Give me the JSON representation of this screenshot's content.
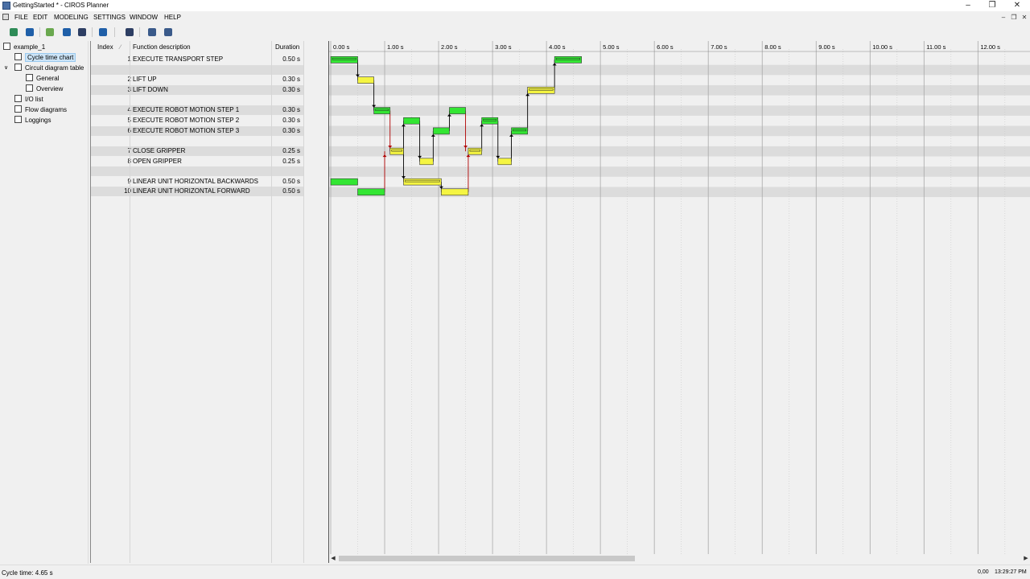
{
  "window": {
    "title": "GettingStarted * - CIROS Planner",
    "min_glyph": "–",
    "max_glyph": "❐",
    "close_glyph": "✕"
  },
  "menu": [
    "FILE",
    "EDIT",
    "MODELING",
    "SETTINGS",
    "WINDOW",
    "HELP"
  ],
  "mdi_controls": [
    "–",
    "❐",
    "✕"
  ],
  "toolbar": {
    "buttons": [
      "open-icon",
      "save-icon",
      "cut-icon",
      "copy-icon",
      "paste-icon",
      "help-icon",
      "window-icon",
      "user-icon",
      "export-icon"
    ],
    "colors": [
      "#2e8b57",
      "#1f5fa8",
      "#6aa84f",
      "#1f5fa8",
      "#2d3e63",
      "#1f5fa8",
      "#2d3e63",
      "#3a5a8a",
      "#3a5a8a"
    ]
  },
  "tree": [
    {
      "label": "example_1",
      "icon": "project-icon",
      "level": 0,
      "expanded": null,
      "selected": false
    },
    {
      "label": "Cycle time chart",
      "icon": "chart-icon",
      "level": 1,
      "expanded": null,
      "selected": true
    },
    {
      "label": "Circuit diagram table",
      "icon": "table-icon",
      "level": 1,
      "expanded": true,
      "selected": false
    },
    {
      "label": "General",
      "icon": "table-icon",
      "level": 2,
      "expanded": null,
      "selected": false
    },
    {
      "label": "Overview",
      "icon": "table-icon",
      "level": 2,
      "expanded": null,
      "selected": false
    },
    {
      "label": "I/O list",
      "icon": "list-icon",
      "level": 1,
      "expanded": null,
      "selected": false
    },
    {
      "label": "Flow diagrams",
      "icon": "flow-icon",
      "level": 1,
      "expanded": null,
      "selected": false
    },
    {
      "label": "Loggings",
      "icon": "log-icon",
      "level": 1,
      "expanded": null,
      "selected": false
    }
  ],
  "table": {
    "headers": {
      "index": "Index",
      "sort": "∕",
      "description": "Function description",
      "duration": "Duration"
    },
    "rows": [
      {
        "index": "1",
        "description": "EXECUTE TRANSPORT STEP",
        "duration": "0.50 s"
      },
      {
        "index": "",
        "description": "",
        "duration": ""
      },
      {
        "index": "2",
        "description": "LIFT UP",
        "duration": "0.30 s"
      },
      {
        "index": "3",
        "description": "LIFT DOWN",
        "duration": "0.30 s"
      },
      {
        "index": "",
        "description": "",
        "duration": ""
      },
      {
        "index": "4",
        "description": "EXECUTE ROBOT MOTION STEP 1",
        "duration": "0.30 s"
      },
      {
        "index": "5",
        "description": "EXECUTE ROBOT MOTION STEP 2",
        "duration": "0.30 s"
      },
      {
        "index": "6",
        "description": "EXECUTE ROBOT MOTION STEP 3",
        "duration": "0.30 s"
      },
      {
        "index": "",
        "description": "",
        "duration": ""
      },
      {
        "index": "7",
        "description": "CLOSE GRIPPER",
        "duration": "0.25 s"
      },
      {
        "index": "8",
        "description": "OPEN GRIPPER",
        "duration": "0.25 s"
      },
      {
        "index": "",
        "description": "",
        "duration": ""
      },
      {
        "index": "9",
        "description": "LINEAR UNIT HORIZONTAL BACKWARDS",
        "duration": "0.50 s"
      },
      {
        "index": "10",
        "description": "LINEAR UNIT HORIZONTAL FORWARD",
        "duration": "0.50 s"
      }
    ]
  },
  "chart_data": {
    "type": "gantt",
    "time_axis_labels": [
      "0.00 s",
      "1.00 s",
      "2.00 s",
      "3.00 s",
      "4.00 s",
      "5.00 s",
      "6.00 s",
      "7.00 s",
      "8.00 s",
      "9.00 s",
      "10.00 s",
      "11.00 s",
      "12.00 s"
    ],
    "x_unit": "s",
    "xlim": [
      0,
      12.95
    ],
    "colors": {
      "green": "#33e633",
      "yellow": "#f5f542",
      "link": "#000000",
      "link_red": "#b00000",
      "grid": "#a9a9a9"
    },
    "bars": [
      {
        "row": 0,
        "start": 0.0,
        "end": 0.5,
        "color": "green",
        "inner": true
      },
      {
        "row": 0,
        "start": 4.15,
        "end": 4.65,
        "color": "green",
        "inner": true
      },
      {
        "row": 2,
        "start": 0.5,
        "end": 0.8,
        "color": "yellow",
        "inner": false
      },
      {
        "row": 3,
        "start": 3.65,
        "end": 4.15,
        "color": "yellow",
        "inner": true
      },
      {
        "row": 5,
        "start": 0.8,
        "end": 1.1,
        "color": "green",
        "inner": true
      },
      {
        "row": 5,
        "start": 2.2,
        "end": 2.5,
        "color": "green",
        "inner": false
      },
      {
        "row": 6,
        "start": 1.35,
        "end": 1.65,
        "color": "green",
        "inner": false
      },
      {
        "row": 6,
        "start": 2.8,
        "end": 3.1,
        "color": "green",
        "inner": true
      },
      {
        "row": 7,
        "start": 1.9,
        "end": 2.2,
        "color": "green",
        "inner": false
      },
      {
        "row": 7,
        "start": 3.35,
        "end": 3.65,
        "color": "green",
        "inner": true
      },
      {
        "row": 9,
        "start": 1.1,
        "end": 1.35,
        "color": "yellow",
        "inner": true
      },
      {
        "row": 9,
        "start": 2.55,
        "end": 2.8,
        "color": "yellow",
        "inner": true
      },
      {
        "row": 10,
        "start": 1.65,
        "end": 1.9,
        "color": "yellow",
        "inner": false
      },
      {
        "row": 10,
        "start": 3.1,
        "end": 3.35,
        "color": "yellow",
        "inner": false
      },
      {
        "row": 12,
        "start": 0.0,
        "end": 0.5,
        "color": "green",
        "inner": false
      },
      {
        "row": 12,
        "start": 1.35,
        "end": 2.05,
        "color": "yellow",
        "inner": true
      },
      {
        "row": 13,
        "start": 0.5,
        "end": 1.0,
        "color": "green",
        "inner": false
      },
      {
        "row": 13,
        "start": 2.05,
        "end": 2.55,
        "color": "yellow",
        "inner": false
      }
    ],
    "links": [
      {
        "t": 0.5,
        "from_row": 0,
        "to_row": 2,
        "color": "link"
      },
      {
        "t": 0.8,
        "from_row": 2,
        "to_row": 5,
        "color": "link"
      },
      {
        "t": 1.1,
        "from_row": 5,
        "to_row": 9,
        "color": "link_red"
      },
      {
        "t": 1.0,
        "from_row": 13,
        "to_row": 9,
        "color": "link_red"
      },
      {
        "t": 1.35,
        "from_row": 9,
        "to_row": 6,
        "color": "link"
      },
      {
        "t": 1.35,
        "from_row": 9,
        "to_row": 12,
        "color": "link"
      },
      {
        "t": 1.65,
        "from_row": 6,
        "to_row": 10,
        "color": "link"
      },
      {
        "t": 1.9,
        "from_row": 10,
        "to_row": 7,
        "color": "link"
      },
      {
        "t": 2.2,
        "from_row": 7,
        "to_row": 5,
        "color": "link"
      },
      {
        "t": 2.05,
        "from_row": 12,
        "to_row": 13,
        "color": "link"
      },
      {
        "t": 2.5,
        "from_row": 5,
        "to_row": 9,
        "color": "link_red"
      },
      {
        "t": 2.55,
        "from_row": 13,
        "to_row": 9,
        "color": "link_red"
      },
      {
        "t": 2.8,
        "from_row": 9,
        "to_row": 6,
        "color": "link"
      },
      {
        "t": 3.1,
        "from_row": 6,
        "to_row": 10,
        "color": "link"
      },
      {
        "t": 3.35,
        "from_row": 10,
        "to_row": 7,
        "color": "link"
      },
      {
        "t": 3.65,
        "from_row": 7,
        "to_row": 3,
        "color": "link"
      },
      {
        "t": 4.15,
        "from_row": 3,
        "to_row": 0,
        "color": "link"
      }
    ]
  },
  "scrollbar": {
    "left_arrow": "◀",
    "right_arrow": "▶"
  },
  "status": {
    "cycle_time": "Cycle time: 4.65 s",
    "value": "0,00",
    "time": "13:29:27 PM"
  }
}
